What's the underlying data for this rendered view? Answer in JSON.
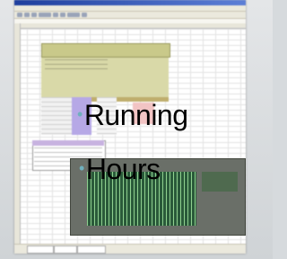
{
  "bullets": [
    {
      "text": "Running"
    },
    {
      "text": "Hours"
    }
  ],
  "colors": {
    "bullet_marker": "#6fb0bd",
    "slide_background": "#d6dadd",
    "chart_plot": "#2a5a3a",
    "olive_header": "#c9c98a",
    "purple_highlight": "#b6a8e6"
  },
  "icons": {
    "bullet": "round-bullet"
  }
}
